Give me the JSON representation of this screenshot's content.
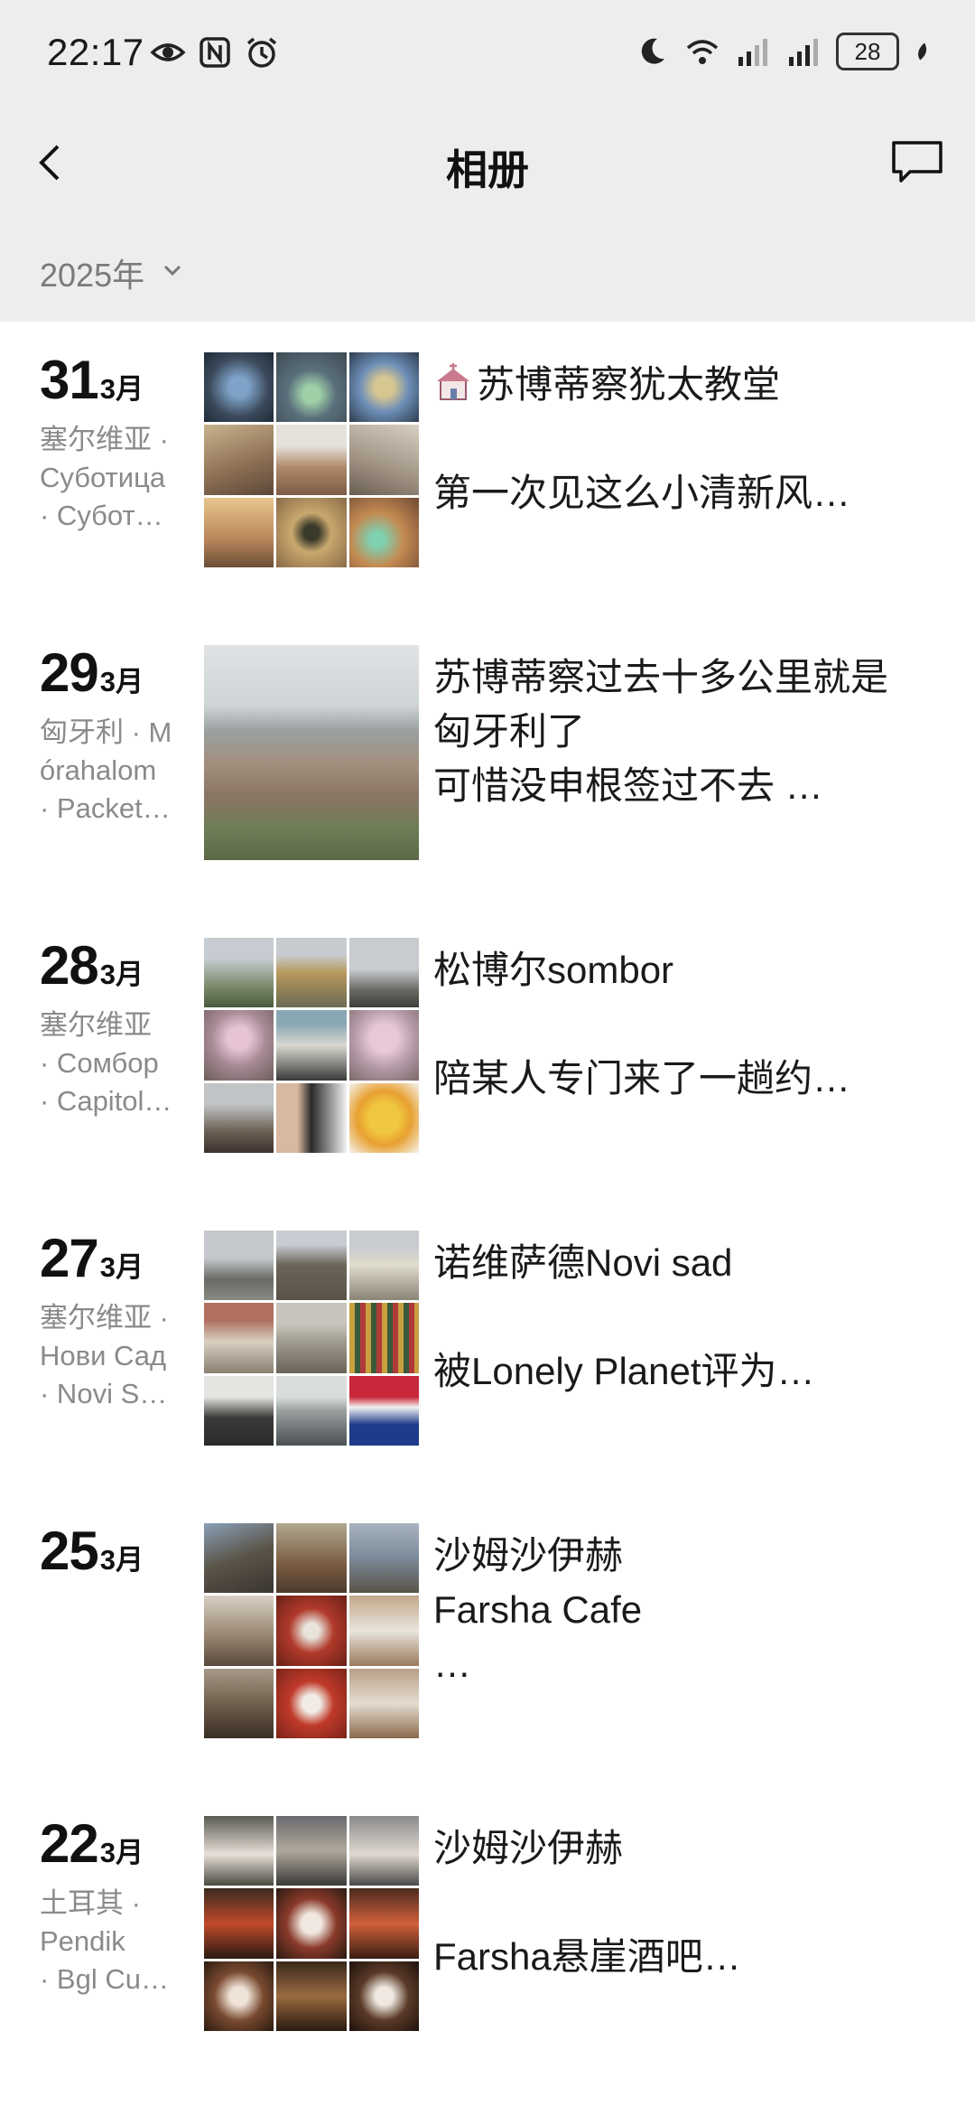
{
  "status": {
    "time": "22:17",
    "battery": "28"
  },
  "nav": {
    "title": "相册"
  },
  "year": {
    "label": "2025年"
  },
  "entries": [
    {
      "day": "31",
      "month": "3月",
      "loc": [
        "塞尔维亚 ·",
        "Суботица",
        "· Субот…"
      ],
      "lines": [
        "苏博蒂察犹太教堂",
        "",
        "第一次见这么小清新风…"
      ],
      "emoji": "church-icon",
      "layout": "grid"
    },
    {
      "day": "29",
      "month": "3月",
      "loc": [
        "匈牙利 · M",
        "órahalom",
        "· Packet…"
      ],
      "lines": [
        "苏博蒂察过去十多公里就是",
        "匈牙利了",
        "可惜没申根签过不去  …"
      ],
      "layout": "single"
    },
    {
      "day": "28",
      "month": "3月",
      "loc": [
        "塞尔维亚",
        "· Сомбор",
        "· Capitol…"
      ],
      "lines": [
        "松博尔sombor",
        "",
        "陪某人专门来了一趟约…"
      ],
      "layout": "grid"
    },
    {
      "day": "27",
      "month": "3月",
      "loc": [
        "塞尔维亚 ·",
        "Нови Сад",
        "· Novi S…"
      ],
      "lines": [
        "诺维萨德Novi sad",
        "",
        "被Lonely Planet评为…"
      ],
      "layout": "grid"
    },
    {
      "day": "25",
      "month": "3月",
      "loc": [],
      "lines": [
        "沙姆沙伊赫",
        "Farsha Cafe",
        "…"
      ],
      "layout": "grid"
    },
    {
      "day": "22",
      "month": "3月",
      "loc": [
        "土耳其 ·",
        "Pendik",
        "· Bgl Cu…"
      ],
      "lines": [
        "沙姆沙伊赫",
        "",
        "Farsha悬崖酒吧…"
      ],
      "layout": "grid"
    }
  ]
}
